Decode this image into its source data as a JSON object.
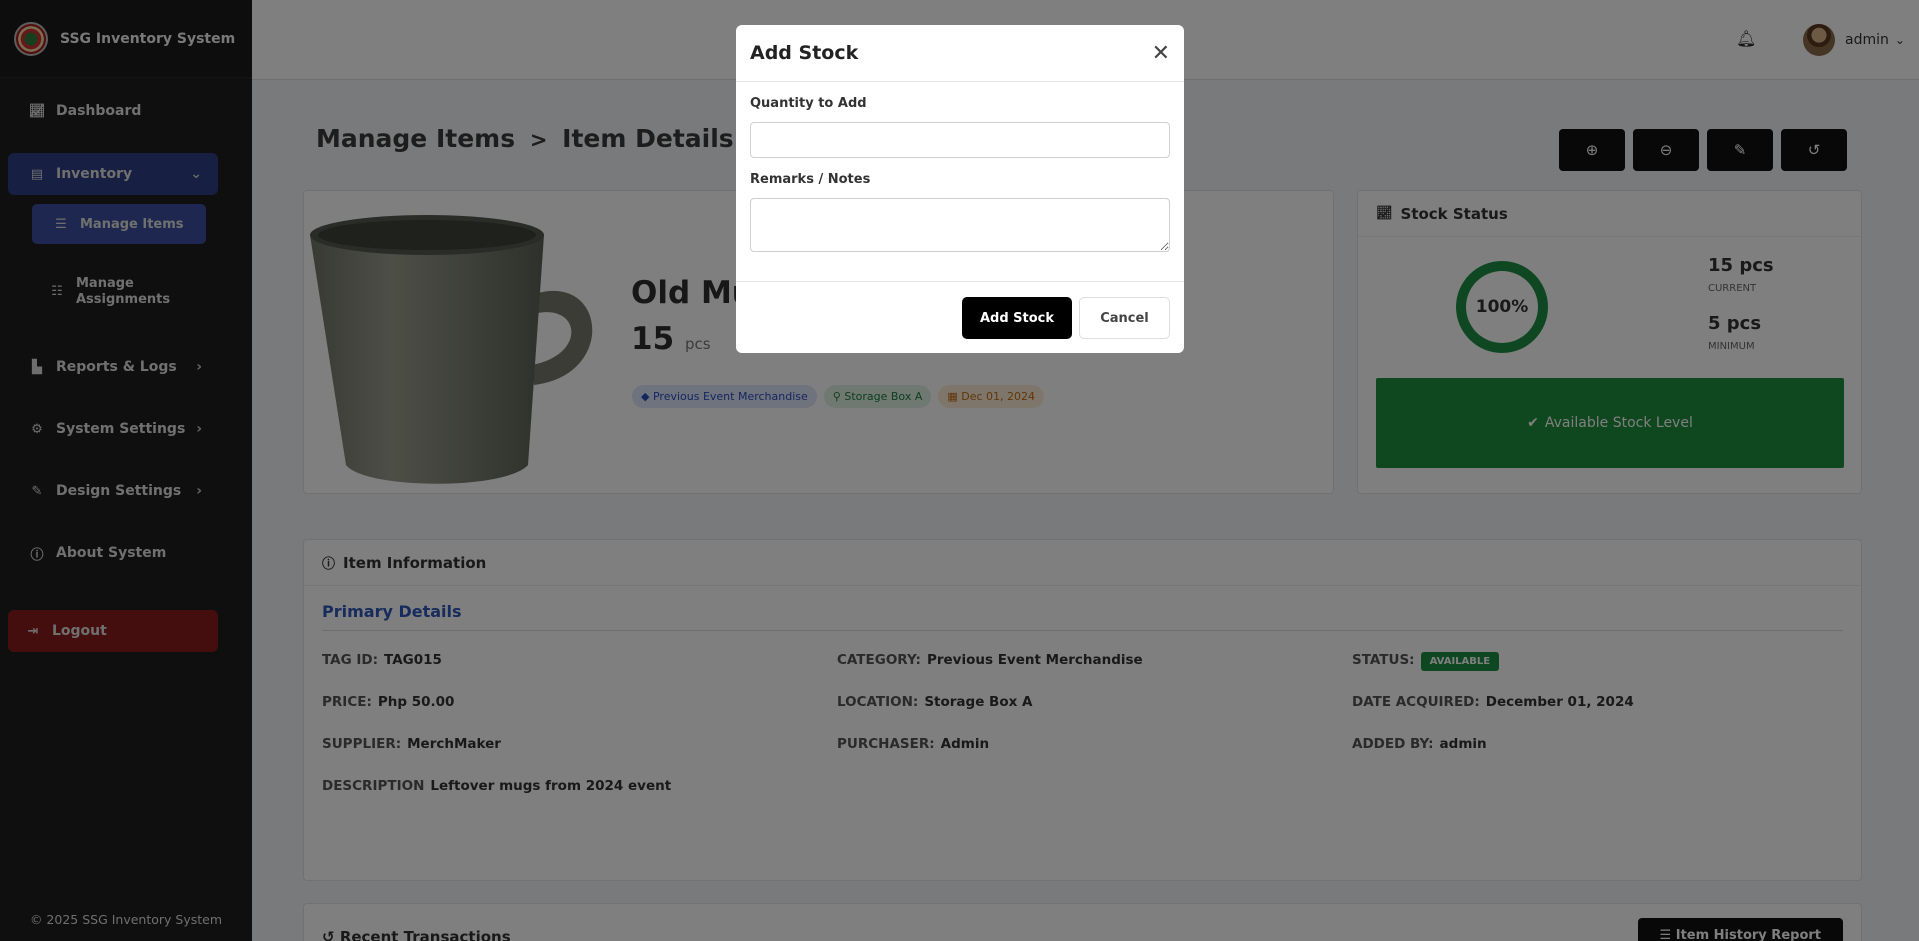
{
  "app": {
    "title": "SSG Inventory System",
    "footer": "© 2025 SSG Inventory System"
  },
  "sidebar": {
    "items": [
      {
        "label": "Dashboard",
        "icon": "chart-line-icon"
      },
      {
        "label": "Inventory",
        "icon": "box-icon"
      },
      {
        "label": "Manage Items",
        "icon": "list-icon"
      },
      {
        "label": "Manage Assignments",
        "icon": "list-check-icon"
      },
      {
        "label": "Reports & Logs",
        "icon": "bar-chart-icon"
      },
      {
        "label": "System Settings",
        "icon": "gears-icon"
      },
      {
        "label": "Design Settings",
        "icon": "brush-icon"
      },
      {
        "label": "About System",
        "icon": "info-icon"
      },
      {
        "label": "Logout",
        "icon": "logout-icon"
      }
    ]
  },
  "topbar": {
    "user": "admin"
  },
  "page": {
    "breadcrumb_root": "Manage Items",
    "breadcrumb_sep": ">",
    "breadcrumb_current": "Item Details"
  },
  "item": {
    "name": "Old Mug",
    "qty": "15",
    "qty_unit": "pcs",
    "badges": [
      "Previous Event Merchandise",
      "Storage Box A",
      "Dec 01, 2024"
    ]
  },
  "stock": {
    "heading": "Stock Status",
    "percent": "100%",
    "current_value": "15 pcs",
    "current_label": "CURRENT",
    "min_value": "5 pcs",
    "min_label": "MINIMUM",
    "level_text": "Available Stock Level",
    "color": "#1e8f44"
  },
  "info": {
    "heading": "Item Information",
    "section": "Primary Details",
    "fields": {
      "tag_id": {
        "k": "TAG ID:",
        "v": "TAG015"
      },
      "category": {
        "k": "CATEGORY:",
        "v": "Previous Event Merchandise"
      },
      "status": {
        "k": "STATUS:",
        "v": "AVAILABLE"
      },
      "price": {
        "k": "PRICE:",
        "v": "Php 50.00"
      },
      "location": {
        "k": "LOCATION:",
        "v": "Storage Box A"
      },
      "date_acquired": {
        "k": "DATE ACQUIRED:",
        "v": "December 01, 2024"
      },
      "supplier": {
        "k": "SUPPLIER:",
        "v": "MerchMaker"
      },
      "purchaser": {
        "k": "PURCHASER:",
        "v": "Admin"
      },
      "added_by": {
        "k": "ADDED BY:",
        "v": "admin"
      },
      "description": {
        "k": "DESCRIPTION",
        "v": "Leftover mugs from 2024 event"
      }
    }
  },
  "transactions": {
    "heading": "Recent Transactions",
    "report_button": "Item History Report"
  },
  "modal": {
    "title": "Add Stock",
    "qty_label": "Quantity to Add",
    "qty_value": "",
    "remarks_label": "Remarks / Notes",
    "remarks_value": "",
    "submit_label": "Add Stock",
    "cancel_label": "Cancel"
  }
}
